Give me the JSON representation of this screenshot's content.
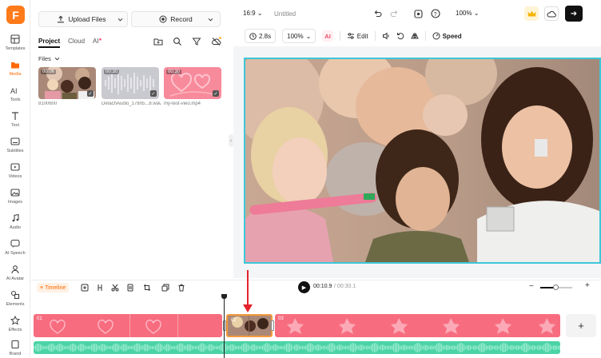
{
  "app": {
    "logo_letter": "F",
    "accent": "#ff7a1a"
  },
  "rail": {
    "items": [
      {
        "label": "Templates",
        "icon": "templates-icon"
      },
      {
        "label": "Media",
        "icon": "folder-icon"
      },
      {
        "label": "Tools",
        "icon": "ai-tools-icon"
      },
      {
        "label": "Text",
        "icon": "text-icon"
      },
      {
        "label": "Subtitles",
        "icon": "subtitles-icon"
      },
      {
        "label": "Videos",
        "icon": "video-icon"
      },
      {
        "label": "Images",
        "icon": "image-icon"
      },
      {
        "label": "Audio",
        "icon": "music-icon"
      },
      {
        "label": "AI Speech",
        "icon": "speech-icon"
      },
      {
        "label": "AI Avatar",
        "icon": "avatar-icon"
      },
      {
        "label": "Elements",
        "icon": "elements-icon"
      },
      {
        "label": "Effects",
        "icon": "effects-icon"
      },
      {
        "label": "Brand",
        "icon": "brand-icon"
      }
    ]
  },
  "media_panel": {
    "upload_label": "Upload Files",
    "record_label": "Record",
    "tabs": [
      {
        "label": "Project"
      },
      {
        "label": "Cloud"
      },
      {
        "label": "AI"
      }
    ],
    "files_heading": "Files",
    "files": [
      {
        "duration": "00:06",
        "name": "8100600"
      },
      {
        "duration": "00:30",
        "name": "DetachAudio_17805...8.wav"
      },
      {
        "duration": "00:30",
        "name": "my-test-vieo.mp4"
      }
    ]
  },
  "topbar": {
    "aspect": "16:9",
    "project_title": "Untitled",
    "zoom": "100%"
  },
  "toolbar": {
    "duration": "2.8s",
    "scale": "100%",
    "ai_label": "AI",
    "edit_label": "Edit",
    "speed_label": "Speed"
  },
  "timeline": {
    "badge_label": "Timeline",
    "current_time": "00:10.9",
    "total_time": "/ 00:30.1",
    "zoom_level": 0.5,
    "clips": [
      {
        "label": "01"
      },
      {
        "label": "02"
      },
      {
        "label": "03"
      }
    ]
  },
  "colors": {
    "clip_pink": "#f76d7f",
    "audio_green": "#4bd3a6",
    "selection_cyan": "#3cc8d8",
    "annotation_red": "#e5232b"
  }
}
